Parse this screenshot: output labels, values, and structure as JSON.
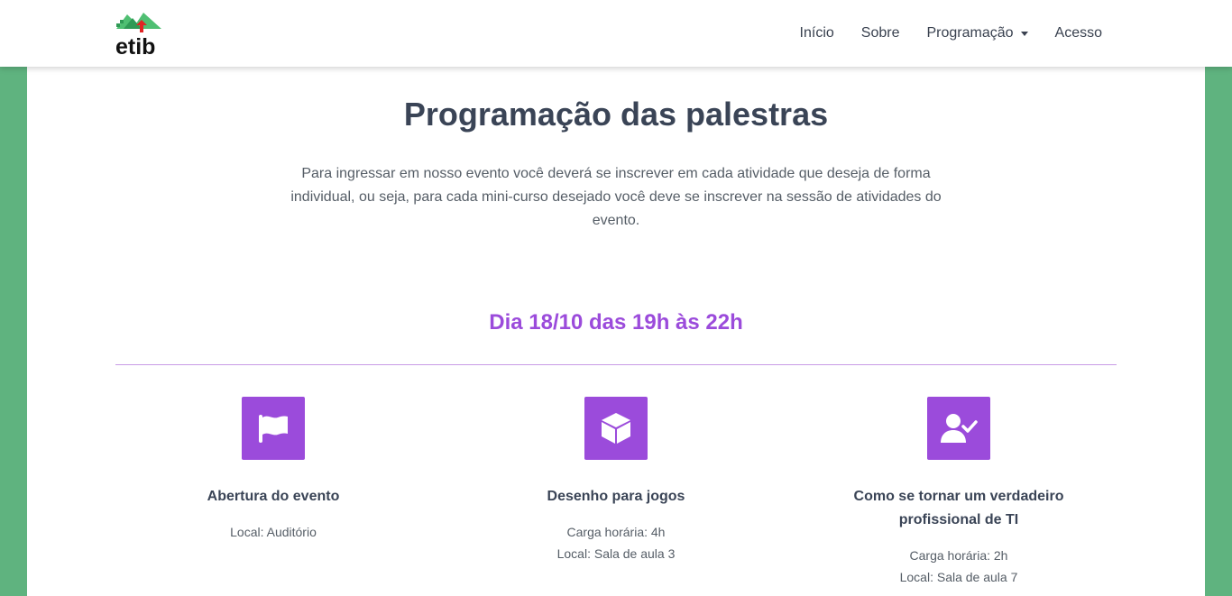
{
  "nav": {
    "logo_text": "etib",
    "links": [
      {
        "label": "Início"
      },
      {
        "label": "Sobre"
      },
      {
        "label": "Programação"
      },
      {
        "label": "Acesso"
      }
    ]
  },
  "page": {
    "title": "Programação das palestras",
    "intro": "Para ingressar em nosso evento você deverá se inscrever em cada atividade que deseja de forma individual, ou seja, para cada mini-curso desejado você deve se inscrever na sessão de atividades do evento."
  },
  "schedule": {
    "day_title": "Dia 18/10 das 19h às 22h",
    "talks": [
      {
        "icon": "flag-icon",
        "title": "Abertura do evento",
        "lines": [
          "Local: Auditório"
        ]
      },
      {
        "icon": "cube-icon",
        "title": "Desenho para jogos",
        "lines": [
          "Carga horária: 4h",
          "Local: Sala de aula 3"
        ]
      },
      {
        "icon": "user-check-icon",
        "title": "Como se tornar um verdadeiro profissional de TI",
        "lines": [
          "Carga horária: 2h",
          "Local: Sala de aula 7"
        ]
      }
    ]
  },
  "colors": {
    "background": "#5fb37f",
    "accent": "#9b4bdb",
    "heading": "#3a4456"
  }
}
